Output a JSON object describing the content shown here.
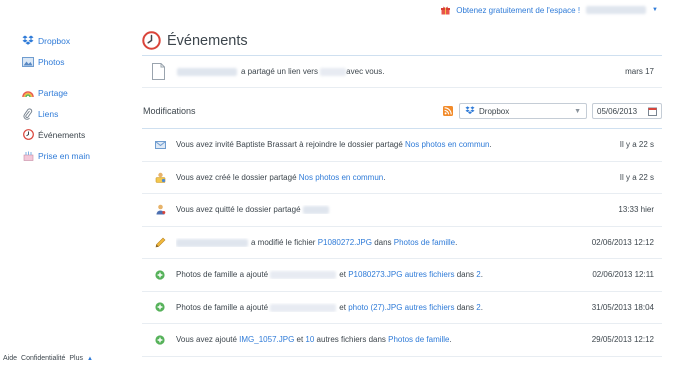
{
  "topbar": {
    "free_space": "Obtenez gratuitement de l'espace !"
  },
  "sidebar": {
    "items": [
      {
        "label": "Dropbox"
      },
      {
        "label": "Photos"
      },
      {
        "label": "Partage"
      },
      {
        "label": "Liens"
      },
      {
        "label": "Événements"
      },
      {
        "label": "Prise en main"
      }
    ]
  },
  "footer": {
    "help": "Aide",
    "privacy": "Confidentialité",
    "more": "Plus",
    "arrow": "▲"
  },
  "main": {
    "title": "Événements",
    "share": {
      "text_a": "a partagé un lien vers",
      "text_b": "avec vous.",
      "date": "mars 17"
    },
    "modifications": {
      "title": "Modifications",
      "filter": "Dropbox",
      "date": "05/06/2013"
    },
    "events": [
      {
        "pre": "Vous avez invité Baptiste Brassart à rejoindre le dossier partagé ",
        "link1": "Nos photos en commun",
        "post": ".",
        "date": "Il y a 22 s"
      },
      {
        "pre": "Vous avez créé le dossier partagé ",
        "link1": "Nos photos en commun",
        "post": ".",
        "date": "Il y a 22 s"
      },
      {
        "pre": "Vous avez quitté le dossier partagé",
        "date": "13:33 hier"
      },
      {
        "mid": "a modifié le fichier ",
        "link1": "P1080272.JPG",
        "mid2": " dans ",
        "link2": "Photos de famille",
        "post": ".",
        "date": "02/06/2013 12:12"
      },
      {
        "pre": "Photos de famille a ajouté",
        "mid": "et ",
        "link1": "P1080273.JPG autres fichiers",
        "mid2": " dans ",
        "link2": "2",
        "post": ".",
        "date": "02/06/2013 12:11"
      },
      {
        "pre": "Photos de famille a ajouté",
        "mid": "et ",
        "link1": "photo (27).JPG autres fichiers",
        "mid2": " dans ",
        "link2": "2",
        "post": ".",
        "date": "31/05/2013 18:04"
      },
      {
        "pre": "Vous avez ajouté ",
        "link1": "IMG_1057.JPG",
        "mid": " et ",
        "link2": "10",
        "mid2": " autres fichiers dans ",
        "link3": "Photos de famille",
        "post": ".",
        "date": "29/05/2013 12:12"
      }
    ]
  }
}
